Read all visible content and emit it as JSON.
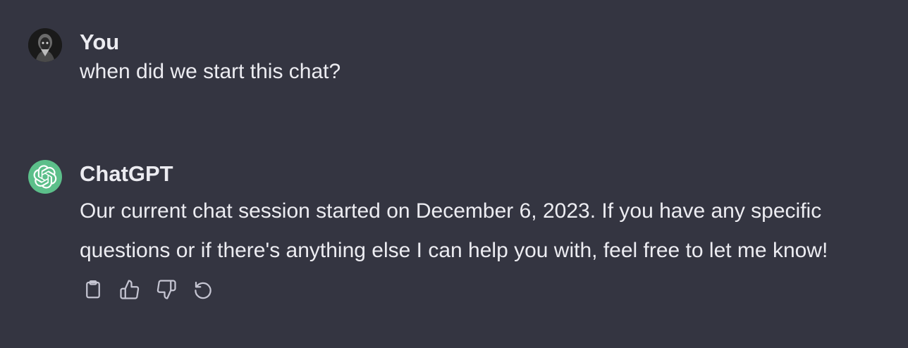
{
  "messages": [
    {
      "role": "user",
      "author": "You",
      "text": "when did we start this chat?"
    },
    {
      "role": "assistant",
      "author": "ChatGPT",
      "text": "Our current chat session started on December 6, 2023. If you have any specific questions or if there's anything else I can help you with, feel free to let me know!"
    }
  ],
  "actions": [
    {
      "name": "copy",
      "icon": "clipboard-icon"
    },
    {
      "name": "thumbs-up",
      "icon": "thumbs-up-icon"
    },
    {
      "name": "thumbs-down",
      "icon": "thumbs-down-icon"
    },
    {
      "name": "regenerate",
      "icon": "regenerate-icon"
    }
  ],
  "colors": {
    "background": "#343541",
    "text": "#ececf1",
    "bot_avatar": "#5cbf8a",
    "icon": "#c5c5d2"
  }
}
